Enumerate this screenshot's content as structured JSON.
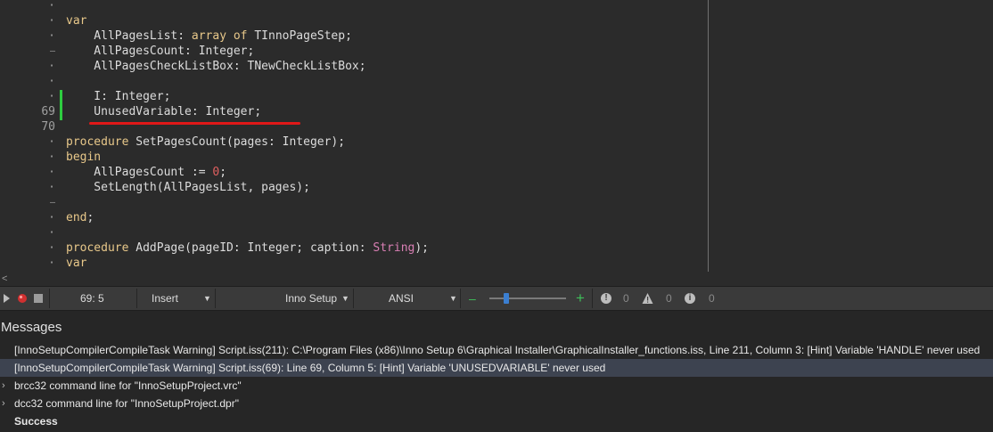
{
  "editor": {
    "gutter": {
      "line_69": "69",
      "line_70": "70"
    },
    "lines": [
      {
        "parts": [
          {
            "t": "var",
            "c": "kw"
          }
        ]
      },
      {
        "parts": [
          {
            "t": "    AllPagesList: ",
            "c": ""
          },
          {
            "t": "array of",
            "c": "kw"
          },
          {
            "t": " TInnoPageStep;",
            "c": ""
          }
        ]
      },
      {
        "parts": [
          {
            "t": "    AllPagesCount: Integer;",
            "c": ""
          }
        ]
      },
      {
        "parts": [
          {
            "t": "    AllPagesCheckListBox: TNewCheckListBox;",
            "c": ""
          }
        ]
      },
      {
        "parts": []
      },
      {
        "parts": [
          {
            "t": "    I: Integer;",
            "c": ""
          }
        ]
      },
      {
        "parts": [
          {
            "t": "    UnusedVariable: Integer;",
            "c": ""
          }
        ]
      },
      {
        "parts": []
      },
      {
        "parts": [
          {
            "t": "procedure",
            "c": "kw"
          },
          {
            "t": " SetPagesCount(pages: Integer);",
            "c": ""
          }
        ]
      },
      {
        "parts": [
          {
            "t": "begin",
            "c": "kw"
          }
        ]
      },
      {
        "parts": [
          {
            "t": "    AllPagesCount := ",
            "c": ""
          },
          {
            "t": "0",
            "c": "num-lit"
          },
          {
            "t": ";",
            "c": ""
          }
        ]
      },
      {
        "parts": [
          {
            "t": "    SetLength(AllPagesList, pages);",
            "c": ""
          }
        ]
      },
      {
        "parts": []
      },
      {
        "parts": [
          {
            "t": "end",
            "c": "kw"
          },
          {
            "t": ";",
            "c": ""
          }
        ]
      },
      {
        "parts": []
      },
      {
        "parts": [
          {
            "t": "procedure",
            "c": "kw"
          },
          {
            "t": " AddPage(pageID: Integer; caption: ",
            "c": ""
          },
          {
            "t": "String",
            "c": "str-kw"
          },
          {
            "t": ");",
            "c": ""
          }
        ]
      },
      {
        "parts": [
          {
            "t": "var",
            "c": "kw"
          }
        ]
      }
    ]
  },
  "status_bar": {
    "position": "69:  5",
    "mode": "Insert",
    "language": "Inno Setup",
    "encoding": "ANSI",
    "zoom_minus": "–",
    "zoom_plus": "+",
    "zoom_level": 0.22,
    "errors_count": "0",
    "warnings_count": "0",
    "info_count": "0",
    "icons": {
      "run": "run-icon",
      "stop": "stop-icon"
    },
    "colors": {
      "zoom_thumb": "#3b7fd1",
      "zoom_plus": "#3fbf5a",
      "run": "#d03030"
    }
  },
  "messages": {
    "title": "Messages",
    "rows": [
      {
        "text": "[InnoSetupCompilerCompileTask Warning] Script.iss(211): C:\\Program Files (x86)\\Inno Setup 6\\Graphical Installer\\GraphicalInstaller_functions.iss, Line 211, Column 3: [Hint] Variable 'HANDLE' never used",
        "expander": ""
      },
      {
        "text": "[InnoSetupCompilerCompileTask Warning] Script.iss(69): Line 69, Column 5: [Hint] Variable 'UNUSEDVARIABLE' never used",
        "expander": ""
      },
      {
        "text": "brcc32 command line for \"InnoSetupProject.vrc\"",
        "expander": "›"
      },
      {
        "text": "dcc32 command line for \"InnoSetupProject.dpr\"",
        "expander": "›"
      },
      {
        "text": "Success",
        "expander": ""
      }
    ]
  }
}
